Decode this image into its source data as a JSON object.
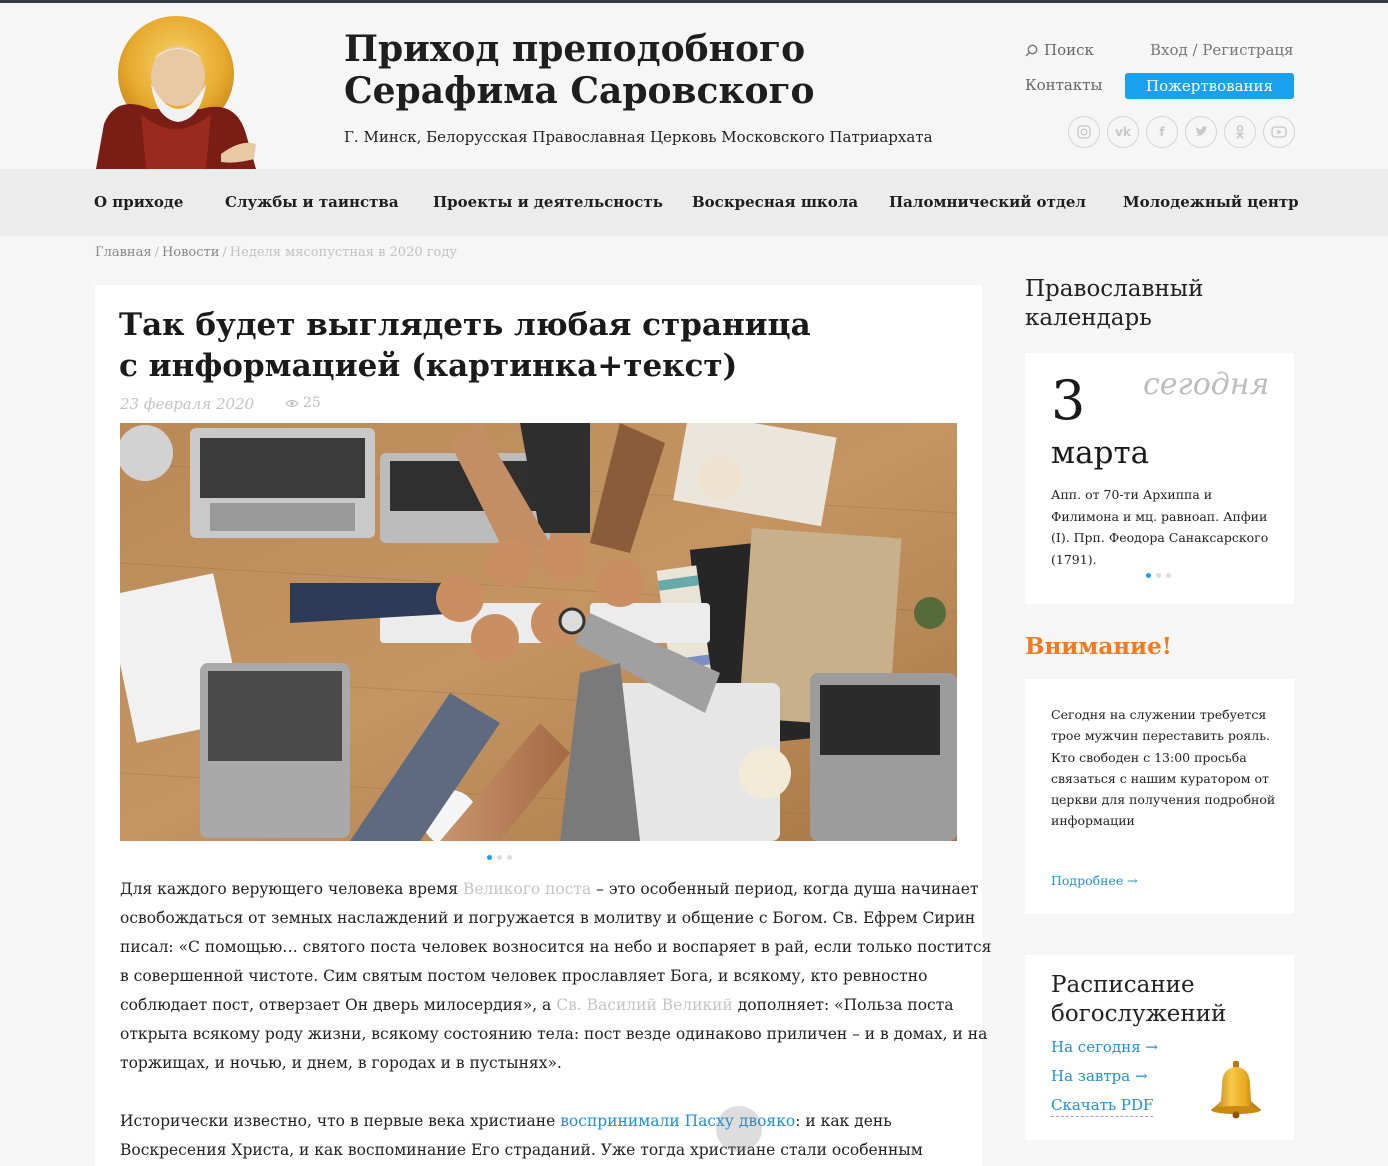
{
  "header": {
    "title_line1": "Приход преподобного",
    "title_line2": "Серафима Саровского",
    "subtitle": "Г. Минск, Белорусская Православная Церковь Московского Патриархата",
    "search_label": "Поиск",
    "login_label": "Вход / Регистраця",
    "contacts_label": "Контакты",
    "donate_label": "Пожертвования",
    "socials": [
      "instagram-icon",
      "vk-icon",
      "facebook-icon",
      "twitter-icon",
      "odnoklassniki-icon",
      "youtube-icon"
    ]
  },
  "nav": {
    "items": [
      {
        "label": "О приходе"
      },
      {
        "label": "Службы и таинства"
      },
      {
        "label": "Проекты и деятельсность"
      },
      {
        "label": "Воскресная школа"
      },
      {
        "label": "Паломнический отдел"
      },
      {
        "label": "Молодежный центр"
      }
    ]
  },
  "breadcrumb": {
    "home": "Главная",
    "section": "Новости",
    "current": "Неделя мясопустная в 2020 году"
  },
  "article": {
    "title_line1": "Так будет выглядеть любая страница",
    "title_line2": "с информацией  (картинка+текст)",
    "date": "23 февраля 2020",
    "views": "25",
    "p1_line1_a": "Для каждого верующего человека время ",
    "p1_line1_link": "Великого поста",
    "p1_line1_b": " – это особенный период, когда душа начинает",
    "p1_line2": "освобождаться от земных наслаждений и погружается в молитву и общение с Богом. Св. Ефрем Сирин",
    "p1_line3": "писал: «С помощью… святого поста человек возносится на небо и воспаряет в рай, если только постится",
    "p1_line4": "в совершенной чистоте. Сим святым постом человек прославляет Бога, и всякому, кто ревностно",
    "p1_line5_a": "соблюдает пост, отверзает Он дверь милосердия», а ",
    "p1_line5_link": "Св. Василий Великий",
    "p1_line5_b": " дополняет: «Польза поста",
    "p1_line6": "открыта всякому роду жизни, всякому состоянию тела: пост везде одинаково приличен – и в домах, и на",
    "p1_line7": "торжищах, и ночью, и днем, в городах и в пустынях».",
    "p2_line1_a": "Исторически известно, что в первые века христиане ",
    "p2_line1_link": "воспринимали Пасху двояко",
    "p2_line1_b": ": и как день",
    "p2_line2": "Воскресения Христа, и как воспоминание Его страданий. Уже тогда христиане стали особенным"
  },
  "calendar": {
    "heading_line1": "Православный",
    "heading_line2": "календарь",
    "day": "3",
    "today_label": "сегодня",
    "month": "марта",
    "description": "Апп. от 70-ти Архиппа и Филимона и мц. равноап. Апфии (I). Прп. Феодора Санаксарского (1791)."
  },
  "attention": {
    "heading": "Внимание!",
    "text": "Сегодня на служении требуется трое мужчин переставить рояль. Кто свободен с 13:00 просьба связаться с нашим куратором от церкви для получения подробной информации",
    "more_label": "Подробнее →"
  },
  "schedule": {
    "heading_line1": "Расписание",
    "heading_line2": "богослужений",
    "today_link": "На сегодня   →",
    "tomorrow_link": "На завтра   →",
    "pdf_link": "Скачать PDF"
  },
  "colors": {
    "accent_blue": "#19a1f0",
    "link_blue": "#1e90d6",
    "attention_orange": "#f47a1f",
    "nav_bg": "#ececec",
    "page_bg": "#f6f6f6"
  }
}
